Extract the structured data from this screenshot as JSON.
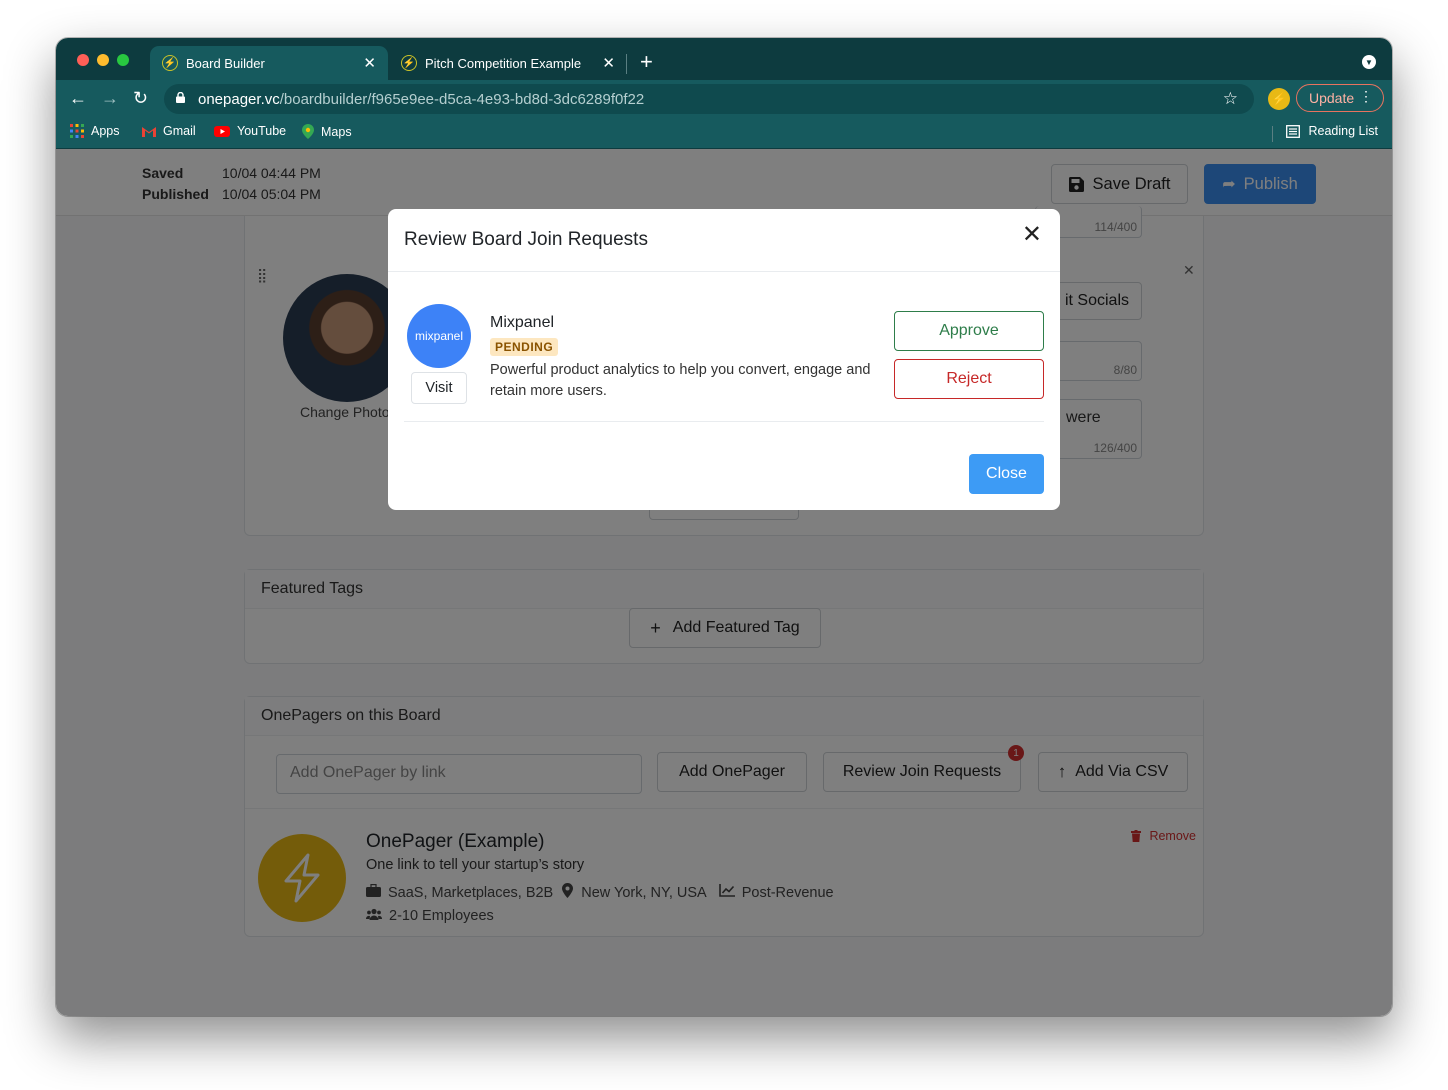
{
  "browser": {
    "tabs": [
      {
        "title": "Board Builder",
        "active": true
      },
      {
        "title": "Pitch Competition Example",
        "active": false
      }
    ],
    "url": {
      "domain": "onepager.vc",
      "path": "/boardbuilder/f965e9ee-d5ca-4e93-bd8d-3dc6289f0f22"
    },
    "update_label": "Update",
    "bookmarks": [
      "Apps",
      "Gmail",
      "YouTube",
      "Maps"
    ],
    "reading_list": "Reading List"
  },
  "header": {
    "saved_label": "Saved",
    "saved_time": "10/04 04:44 PM",
    "published_label": "Published",
    "published_time": "10/04 05:04 PM",
    "save_draft": "Save Draft",
    "publish": "Publish"
  },
  "member_card": {
    "change_photo": "Change Photo",
    "socials_button": "it Socials",
    "counter_top": "114/400",
    "counter_name": "8/80",
    "bio_fragment": "were",
    "counter_bio": "126/400"
  },
  "featured_tags": {
    "title": "Featured Tags",
    "add_button": "Add Featured Tag"
  },
  "onepagers": {
    "title": "OnePagers on this Board",
    "input_placeholder": "Add OnePager by link",
    "add_button": "Add OnePager",
    "review_button": "Review Join Requests",
    "review_badge": "1",
    "csv_button": "Add Via CSV",
    "item": {
      "name": "OnePager (Example)",
      "tagline": "One link to tell your startup’s story",
      "industries": "SaaS, Marketplaces, B2B",
      "location": "New York, NY, USA",
      "stage": "Post-Revenue",
      "employees": "2-10 Employees",
      "remove": "Remove"
    }
  },
  "modal": {
    "title": "Review Board Join Requests",
    "request": {
      "logo_text": "mixpanel",
      "company": "Mixpanel",
      "status": "PENDING",
      "description": "Powerful product analytics to help you convert, engage and retain more users.",
      "visit": "Visit",
      "approve": "Approve",
      "reject": "Reject"
    },
    "close": "Close"
  },
  "colors": {
    "chrome_dark": "#0d3b3f",
    "chrome": "#165a5e",
    "primary": "#3b8ef0",
    "approve": "#2e7d4a",
    "reject": "#c62828",
    "onepager_logo": "#e8b915"
  }
}
